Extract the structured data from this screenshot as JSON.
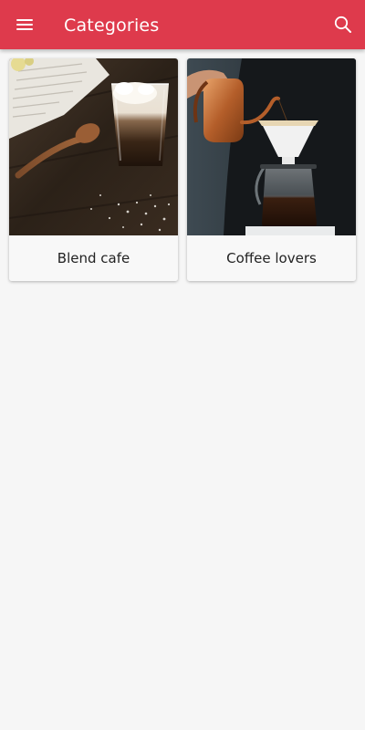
{
  "app_bar": {
    "title": "Categories",
    "menu_icon": "hamburger-menu-icon",
    "search_icon": "search-icon",
    "background_color": "#de3a4c"
  },
  "categories": [
    {
      "label": "Blend cafe",
      "image": "coffee-glass-with-cream-and-wooden-spoon"
    },
    {
      "label": "Coffee lovers",
      "image": "pour-over-coffee-with-copper-kettle"
    }
  ]
}
